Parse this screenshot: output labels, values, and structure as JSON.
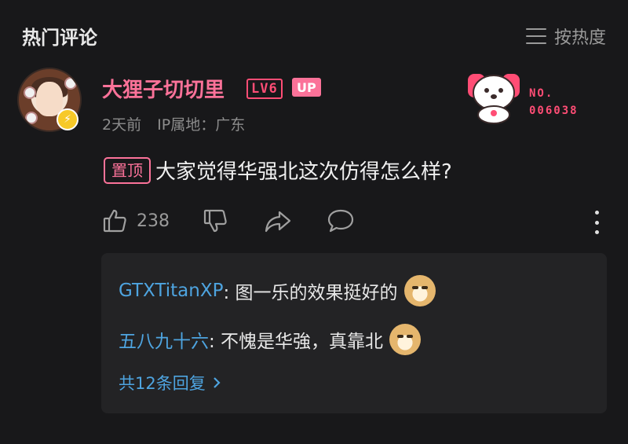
{
  "header": {
    "title": "热门评论",
    "sort_label": "按热度"
  },
  "comment": {
    "username": "大狸子切切里",
    "level": "LV6",
    "up_badge": "UP",
    "time": "2天前",
    "ip": "IP属地：广东",
    "fan_no_line1": "NO.",
    "fan_no_line2": "006038",
    "pinned_tag": "置顶",
    "text": "大家觉得华强北这次仿得怎么样?",
    "like_count": "238"
  },
  "replies": {
    "items": [
      {
        "user": "GTXTitanXP",
        "text": ": 图一乐的效果挺好的",
        "emoji": "doge-emoji"
      },
      {
        "user": "五八九十六",
        "text": ": 不愧是华強，真靠北",
        "emoji": "doge-emoji"
      }
    ],
    "more_label": "共12条回复"
  },
  "colors": {
    "accent_pink": "#fb7299",
    "link_blue": "#4ea4e0",
    "bg": "#18181a"
  }
}
